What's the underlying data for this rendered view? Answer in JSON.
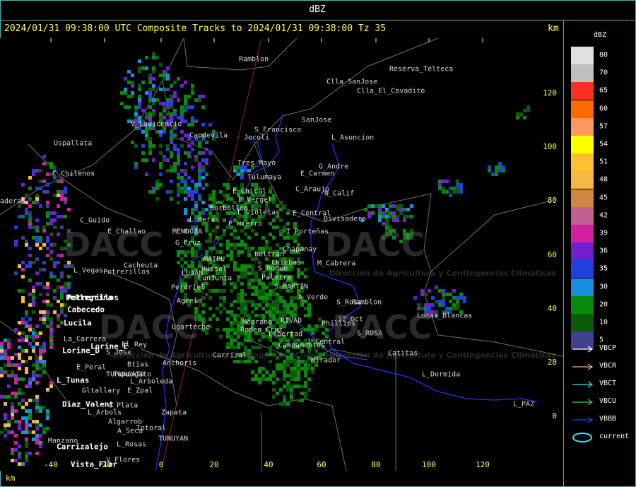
{
  "header": {
    "title": "dBZ",
    "subtitle": "2024/01/31 09:38:00 UTC Composite Tracks to 2024/01/31 09:38:00 Tz 35",
    "km_unit": "km"
  },
  "x_axis": {
    "label": "km",
    "ticks": [
      "-40",
      "-20",
      "0",
      "20",
      "40",
      "60",
      "80",
      "100",
      "120"
    ]
  },
  "y_axis": {
    "ticks": [
      "120",
      "100",
      "80",
      "60",
      "40",
      "20",
      "0"
    ]
  },
  "legend": {
    "title": "dBZ",
    "levels": [
      {
        "label": "80",
        "color": "#e0e0e0"
      },
      {
        "label": "70",
        "color": "#bfbfbf"
      },
      {
        "label": "65",
        "color": "#ff3020"
      },
      {
        "label": "60",
        "color": "#ff6a00"
      },
      {
        "label": "57",
        "color": "#ff9860"
      },
      {
        "label": "54",
        "color": "#ffff00"
      },
      {
        "label": "51",
        "color": "#ffc030"
      },
      {
        "label": "48",
        "color": "#f5b840"
      },
      {
        "label": "45",
        "color": "#d08840"
      },
      {
        "label": "42",
        "color": "#c06090"
      },
      {
        "label": "39",
        "color": "#d01fa0"
      },
      {
        "label": "36",
        "color": "#7020d0"
      },
      {
        "label": "35",
        "color": "#2040e0"
      },
      {
        "label": "30",
        "color": "#1890e0"
      },
      {
        "label": "20",
        "color": "#0a8a0a"
      },
      {
        "label": "10",
        "color": "#0a5a0a"
      },
      {
        "label": "5",
        "color": "#404090"
      }
    ],
    "keys": [
      {
        "label": "VBCP",
        "color": "#ffffff",
        "icon": "arrow-icon"
      },
      {
        "label": "VBCR",
        "color": "#f0b080",
        "icon": "arrow-icon"
      },
      {
        "label": "VBCT",
        "color": "#40e0e0",
        "icon": "arrow-icon"
      },
      {
        "label": "VBCU",
        "color": "#40d040",
        "icon": "arrow-icon"
      },
      {
        "label": "VBBB",
        "color": "#2040ff",
        "icon": "arrow-icon"
      },
      {
        "label": "current",
        "color": "#40e0ff",
        "icon": "ellipse-icon"
      }
    ]
  },
  "watermark": {
    "text": "DACC",
    "caption": "Dirección de Agricultura y Contingencias Climáticas"
  },
  "towns": [
    {
      "name": "Ramblon"
    },
    {
      "name": "Reserva_Telteca"
    },
    {
      "name": "Clla_SanJose"
    },
    {
      "name": "Clla_El_Cavadito"
    },
    {
      "name": "V_Lavicencio"
    },
    {
      "name": "Uspallata"
    },
    {
      "name": "Capdevila"
    },
    {
      "name": "S_Francisco"
    },
    {
      "name": "Jocoli"
    },
    {
      "name": "SanJose"
    },
    {
      "name": "L_Asuncion"
    },
    {
      "name": "C_Chilenos"
    },
    {
      "name": "Tres_Mayo"
    },
    {
      "name": "E_Carmen"
    },
    {
      "name": "Tulumaya"
    },
    {
      "name": "G_Andre"
    },
    {
      "name": "E_Chical"
    },
    {
      "name": "C_Araujo"
    },
    {
      "name": "E_Vergel"
    },
    {
      "name": "N_Calif"
    },
    {
      "name": "Borbollon"
    },
    {
      "name": "L_Violetas"
    },
    {
      "name": "E_Central"
    },
    {
      "name": "Divisadero"
    },
    {
      "name": "C_Guido"
    },
    {
      "name": "E_Challao"
    },
    {
      "name": "L_Heras"
    },
    {
      "name": "P_Hierro"
    },
    {
      "name": "MENDOZA"
    },
    {
      "name": "T_Porteñas"
    },
    {
      "name": "G_Cruz"
    },
    {
      "name": "Chapanay"
    },
    {
      "name": "Beltran"
    },
    {
      "name": "MAIPU"
    },
    {
      "name": "Chimbas"
    },
    {
      "name": "M_Cabrera"
    },
    {
      "name": "L_Vegas"
    },
    {
      "name": "Potrerillos"
    },
    {
      "name": "Cacheuta"
    },
    {
      "name": "Russel"
    },
    {
      "name": "S_Roque"
    },
    {
      "name": "LUJAN"
    },
    {
      "name": "LunJunta"
    },
    {
      "name": "Palmira"
    },
    {
      "name": "Perdriel"
    },
    {
      "name": "S_MARTIN"
    },
    {
      "name": "Potrerillos"
    },
    {
      "name": "Pellegrina"
    },
    {
      "name": "Agrelo"
    },
    {
      "name": "A_Verde"
    },
    {
      "name": "Cabecedo"
    },
    {
      "name": "S_Rosa"
    },
    {
      "name": "Ramblon"
    },
    {
      "name": "Lucila"
    },
    {
      "name": "Ugarteche"
    },
    {
      "name": "Medrano"
    },
    {
      "name": "Rodeo_Cruz"
    },
    {
      "name": "RIVAD"
    },
    {
      "name": "Phillips"
    },
    {
      "name": "12_Oct"
    },
    {
      "name": "S_ROSA"
    },
    {
      "name": "Lomas_Blancas"
    },
    {
      "name": "La_Carrera"
    },
    {
      "name": "Libertad"
    },
    {
      "name": "J_Central"
    },
    {
      "name": "Lorine_D"
    },
    {
      "name": "Lorine_E"
    },
    {
      "name": "El_Rey"
    },
    {
      "name": "Campamentos"
    },
    {
      "name": "S_Jose"
    },
    {
      "name": "Carrizal"
    },
    {
      "name": "Catitas"
    },
    {
      "name": "Anchoris"
    },
    {
      "name": "E_Peral"
    },
    {
      "name": "Tupungato"
    },
    {
      "name": "Btias"
    },
    {
      "name": "Mirador"
    },
    {
      "name": "L_Dormida"
    },
    {
      "name": "TUPUNGATO"
    },
    {
      "name": "L_Tunas"
    },
    {
      "name": "L_Arboleda"
    },
    {
      "name": "Gltallary"
    },
    {
      "name": "E_Zpal"
    },
    {
      "name": "L_PAZ"
    },
    {
      "name": "Diaz_Valent"
    },
    {
      "name": "d_Plata"
    },
    {
      "name": "Zapata"
    },
    {
      "name": "L_Arbols"
    },
    {
      "name": "Algarrob"
    },
    {
      "name": "Totoral"
    },
    {
      "name": "A_Seca"
    },
    {
      "name": "Manzano"
    },
    {
      "name": "TUNUYAN"
    },
    {
      "name": "Carrizalejo"
    },
    {
      "name": "L_Rosas"
    },
    {
      "name": "V_Flores"
    },
    {
      "name": "Vista_Flor"
    },
    {
      "name": "aderas"
    }
  ]
}
